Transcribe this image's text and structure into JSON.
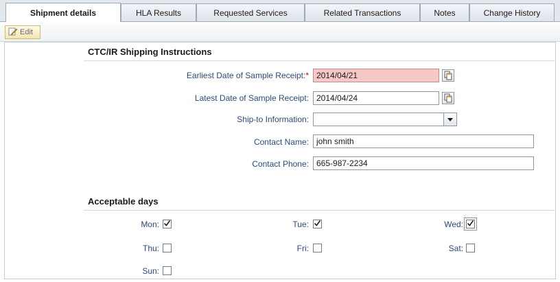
{
  "tabs": [
    {
      "label": "Shipment details",
      "active": true
    },
    {
      "label": "HLA Results",
      "active": false
    },
    {
      "label": "Requested Services",
      "active": false
    },
    {
      "label": "Related Transactions",
      "active": false
    },
    {
      "label": "Notes",
      "active": false
    },
    {
      "label": "Change History",
      "active": false
    }
  ],
  "toolbar": {
    "edit_label": "Edit"
  },
  "shipping": {
    "title": "CTC/IR Shipping Instructions",
    "earliest_label": "Earliest Date of Sample Receipt:",
    "required_mark": "*",
    "earliest_value": "2014/04/21",
    "latest_label": "Latest Date of Sample Receipt:",
    "latest_value": "2014/04/24",
    "shipto_label": "Ship-to Information:",
    "shipto_value": "",
    "contact_name_label": "Contact Name:",
    "contact_name_value": "john smith",
    "contact_phone_label": "Contact Phone:",
    "contact_phone_value": "665-987-2234"
  },
  "days": {
    "title": "Acceptable days",
    "items": [
      {
        "label": "Mon:",
        "checked": true
      },
      {
        "label": "Tue:",
        "checked": true
      },
      {
        "label": "Wed:",
        "checked": true
      },
      {
        "label": "Thu:",
        "checked": false
      },
      {
        "label": "Fri:",
        "checked": false
      },
      {
        "label": "Sat:",
        "checked": false
      },
      {
        "label": "Sun:",
        "checked": false
      }
    ]
  },
  "colors": {
    "error_field_bg": "#f6c9c8",
    "label_blue": "#2b4a7a",
    "required_red": "#d00000"
  },
  "icons": [
    "edit-icon",
    "calendar-icon",
    "chevron-down-icon",
    "checkmark-icon"
  ]
}
